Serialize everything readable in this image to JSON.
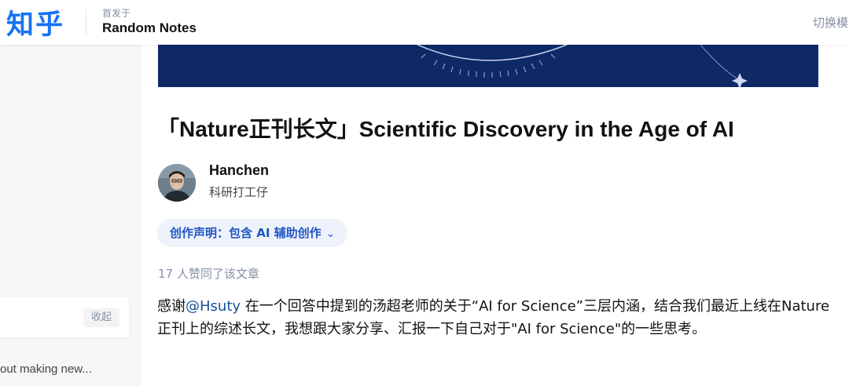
{
  "header": {
    "logo": "知乎",
    "published_in_label": "首发于",
    "column_name": "Random Notes",
    "switch_theme": "切换模式"
  },
  "sidebar": {
    "collapse_label": "收起",
    "snippet": "out making new..."
  },
  "article": {
    "title": "「Nature正刊长文」Scientific Discovery in the Age of AI",
    "author": {
      "name": "Hanchen",
      "bio": "科研打工仔"
    },
    "declaration": "创作声明：包含 AI 辅助创作",
    "likes": "17 人赞同了该文章",
    "body": {
      "p1_before": "感谢",
      "p1_mention": "@Hsuty",
      "p1_after": " 在一个回答中提到的汤超老师的关于“AI for Science”三层内涵，结合我们最近上线在Nature正刊上的综述长文，我想跟大家分享、汇报一下自己对于\"AI for Science\"的一些思考。"
    }
  },
  "colors": {
    "brand": "#1772f6",
    "cover_bg": "#102a66",
    "declaration_text": "#1f55c3",
    "mention": "#175199"
  },
  "icons": [
    "chevron-down-icon"
  ]
}
